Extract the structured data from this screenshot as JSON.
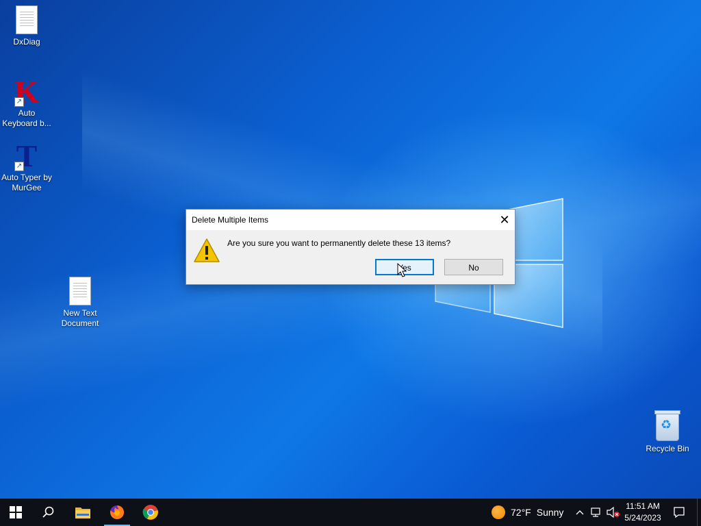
{
  "desktop": {
    "icons": [
      {
        "label_line1": "DxDiag",
        "label_line2": "",
        "type": "document"
      },
      {
        "label_line1": "Auto",
        "label_line2": "Keyboard b...",
        "type": "shortcut",
        "letter": "K",
        "color": "#d0021b"
      },
      {
        "label_line1": "Auto Typer by",
        "label_line2": "MurGee",
        "type": "shortcut",
        "letter": "T",
        "color": "#0b1f8f"
      },
      {
        "label_line1": "New Text",
        "label_line2": "Document",
        "type": "document"
      },
      {
        "label_line1": "Recycle Bin",
        "label_line2": "",
        "type": "recycle-bin"
      }
    ]
  },
  "dialog": {
    "title": "Delete Multiple Items",
    "close_glyph": "✕",
    "message": "Are you sure you want to permanently delete these 13 items?",
    "yes_label": "Yes",
    "no_label": "No",
    "icon": "warning-icon"
  },
  "taskbar": {
    "apps": [
      {
        "name": "start",
        "icon": "windows-logo-icon"
      },
      {
        "name": "search",
        "icon": "search-icon"
      },
      {
        "name": "file-explorer",
        "icon": "folder-icon"
      },
      {
        "name": "firefox",
        "icon": "firefox-icon",
        "active": true
      },
      {
        "name": "chrome",
        "icon": "chrome-icon"
      }
    ],
    "weather": {
      "temp": "72°F",
      "condition": "Sunny"
    },
    "tray": {
      "chevron": "^",
      "network": "network-icon",
      "volume": "volume-muted-icon"
    },
    "clock": {
      "time": "11:51 AM",
      "date": "5/24/2023"
    }
  },
  "colors": {
    "accent": "#0078d7",
    "taskbar": "#0d1117",
    "desktop_blue": "#0b5fd0",
    "warning_yellow": "#f5c400"
  }
}
